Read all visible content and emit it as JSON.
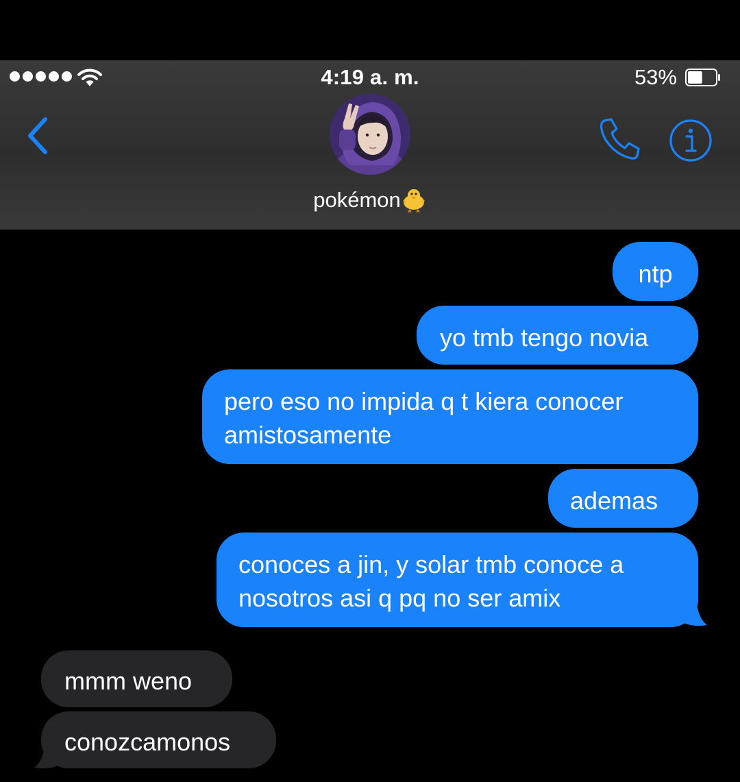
{
  "status_bar": {
    "time": "4:19 a. m.",
    "battery_percent": "53%",
    "battery_level": 0.53,
    "signal_bars": 5
  },
  "nav": {
    "contact_name": "pokémon",
    "contact_emoji": "chick-emoji",
    "back_icon": "chevron-left-icon",
    "call_icon": "phone-icon",
    "info_icon": "info-icon"
  },
  "colors": {
    "accent": "#1a82fb",
    "sent_bubble": "#1a82fb",
    "received_bubble": "#262628",
    "header_bg": "#333333"
  },
  "messages": [
    {
      "direction": "sent",
      "lines": [
        "ntp"
      ]
    },
    {
      "direction": "sent",
      "lines": [
        "yo tmb tengo novia"
      ]
    },
    {
      "direction": "sent",
      "lines": [
        "pero eso no impida q t kiera conocer",
        "amistosamente"
      ]
    },
    {
      "direction": "sent",
      "lines": [
        "ademas"
      ]
    },
    {
      "direction": "sent",
      "lines": [
        "conoces a jin, y solar tmb conoce a",
        "nosotros asi q pq no ser amix"
      ]
    },
    {
      "direction": "received",
      "lines": [
        "mmm weno"
      ]
    },
    {
      "direction": "received",
      "lines": [
        "conozcamonos"
      ]
    }
  ]
}
